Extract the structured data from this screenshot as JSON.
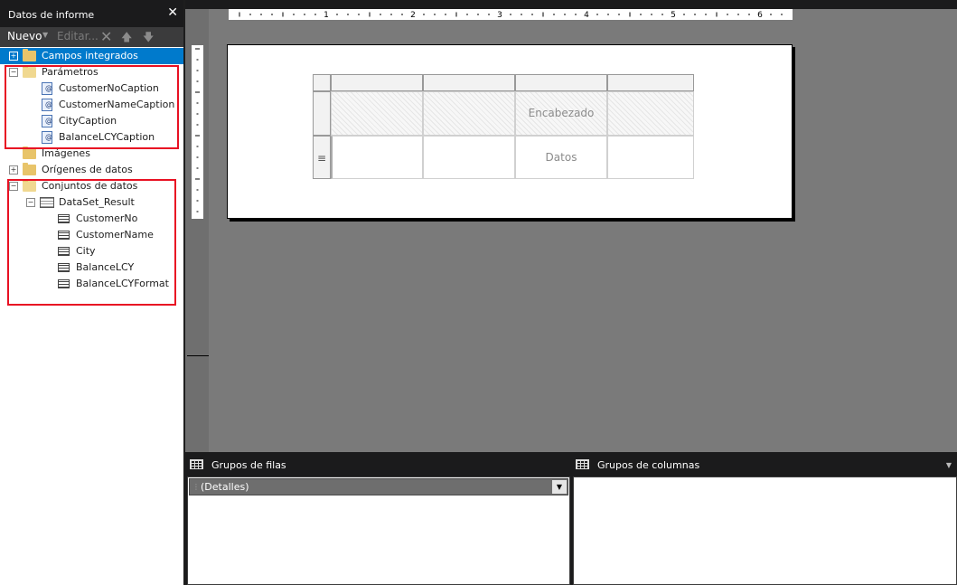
{
  "panel": {
    "title": "Datos de informe",
    "close_glyph": "✕",
    "toolbar": {
      "new_label": "Nuevo",
      "edit_label": "Editar..."
    }
  },
  "tree": {
    "builtin_fields": "Campos integrados",
    "parameters": {
      "label": "Parámetros",
      "items": [
        "CustomerNoCaption",
        "CustomerNameCaption",
        "CityCaption",
        "BalanceLCYCaption"
      ]
    },
    "images": "Imágenes",
    "data_sources": "Orígenes de datos",
    "datasets": {
      "label": "Conjuntos de datos",
      "dataset": {
        "name": "DataSet_Result",
        "fields": [
          "CustomerNo",
          "CustomerName",
          "City",
          "BalanceLCY",
          "BalanceLCYFormat"
        ]
      }
    }
  },
  "designer": {
    "ruler_numbers": [
      "1",
      "2",
      "3",
      "4",
      "5",
      "6"
    ],
    "tablix": {
      "header_text": "Encabezado",
      "data_text": "Datos",
      "row_handle_glyph": "≡"
    }
  },
  "grouping": {
    "row_groups_title": "Grupos de filas",
    "column_groups_title": "Grupos de columnas",
    "detail_group": "(Detalles)"
  },
  "colors": {
    "selection": "#007acc",
    "highlight": "#e81123",
    "dark": "#1b1b1c",
    "canvas": "#7a7a7a"
  }
}
